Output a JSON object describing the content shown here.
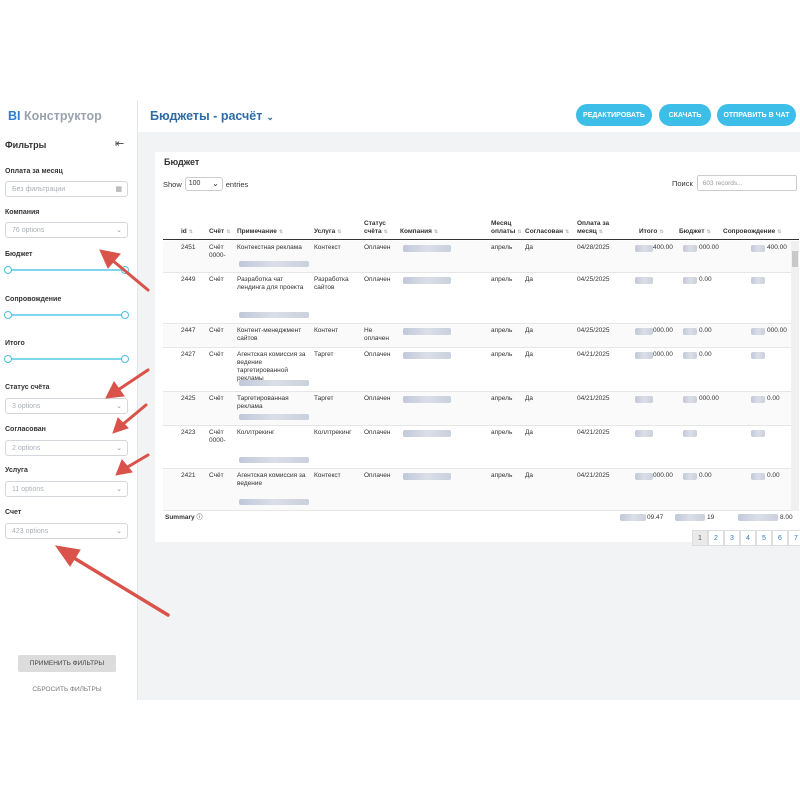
{
  "app": {
    "logo_bi": "BI",
    "logo_text": "Конструктор"
  },
  "header": {
    "title": "Бюджеты - расчёт",
    "buttons": [
      "РЕДАКТИРОВАТЬ",
      "СКАЧАТЬ",
      "ОТПРАВИТЬ В ЧАТ"
    ]
  },
  "sidebar": {
    "title": "Фильтры",
    "filters": {
      "payment_month": {
        "label": "Оплата за месяц",
        "placeholder": "Без фильтрации"
      },
      "company": {
        "label": "Компания",
        "value": "76 options"
      },
      "budget": {
        "label": "Бюджет"
      },
      "support": {
        "label": "Сопровождение"
      },
      "total": {
        "label": "Итого"
      },
      "invoice_status": {
        "label": "Статус счёта",
        "value": "3 options"
      },
      "agreed": {
        "label": "Согласован",
        "value": "2 options"
      },
      "service": {
        "label": "Услуга",
        "value": "11 options"
      },
      "invoice": {
        "label": "Счет",
        "value": "423 options"
      }
    },
    "apply_label": "ПРИМЕНИТЬ ФИЛЬТРЫ",
    "reset_label": "СБРОСИТЬ ФИЛЬТРЫ"
  },
  "table_card": {
    "title": "Бюджет",
    "show_label": "Show",
    "show_value": "100",
    "entries_label": "entries",
    "search_label": "Поиск",
    "search_placeholder": "603 records...",
    "columns": [
      "id",
      "Счёт",
      "Примечание",
      "Услуга",
      "Статус счёта",
      "Компания",
      "Месяц оплаты",
      "Согласован",
      "Оплата за месяц",
      "Итого",
      "Бюджет",
      "Сопровождение"
    ],
    "rows": [
      {
        "id": "2451",
        "invoice": "Счёт 0000-",
        "note": "Контекстная реклама",
        "service": "Контекст",
        "status": "Оплачен",
        "month": "апрель",
        "agreed": "Да",
        "date": "04/28/2025",
        "total": "400.00",
        "budget": "000.00",
        "support": "400.00"
      },
      {
        "id": "2449",
        "invoice": "Счёт",
        "note": "Разработка чат лендинга для проекта",
        "service": "Разработка сайтов",
        "status": "Оплачен",
        "month": "апрель",
        "agreed": "Да",
        "date": "04/25/2025",
        "total": "",
        "budget": "0.00",
        "support": ""
      },
      {
        "id": "2447",
        "invoice": "Счёт",
        "note": "Контент-менеджмент сайтов",
        "service": "Контент",
        "status": "Не оплачен",
        "month": "апрель",
        "agreed": "Да",
        "date": "04/25/2025",
        "total": "000.00",
        "budget": "0.00",
        "support": "000.00"
      },
      {
        "id": "2427",
        "invoice": "Счёт",
        "note": "Агентская комиссия за ведение таргетированной рекламы",
        "service": "Таргет",
        "status": "Оплачен",
        "month": "апрель",
        "agreed": "Да",
        "date": "04/21/2025",
        "total": "000.00",
        "budget": "0.00",
        "support": ""
      },
      {
        "id": "2425",
        "invoice": "Счёт",
        "note": "Таргетированная реклама",
        "service": "Таргет",
        "status": "Оплачен",
        "month": "апрель",
        "agreed": "Да",
        "date": "04/21/2025",
        "total": "",
        "budget": "000.00",
        "support": "0.00"
      },
      {
        "id": "2423",
        "invoice": "Счёт 0000-",
        "note": "Коллтрекинг",
        "service": "Коллтрекинг",
        "status": "Оплачен",
        "month": "апрель",
        "agreed": "Да",
        "date": "04/21/2025",
        "total": "",
        "budget": "",
        "support": ""
      },
      {
        "id": "2421",
        "invoice": "Счёт",
        "note": "Агентская комиссия за ведение",
        "service": "Контекст",
        "status": "Оплачен",
        "month": "апрель",
        "agreed": "Да",
        "date": "04/21/2025",
        "total": "000.00",
        "budget": "0.00",
        "support": "0.00"
      }
    ],
    "summary": {
      "label": "Summary",
      "total": "09.47",
      "budget": "19",
      "support": "8.00"
    },
    "pages": [
      "1",
      "2",
      "3",
      "4",
      "5",
      "6",
      "7"
    ],
    "active_page": "1"
  },
  "colors": {
    "accent": "#3dbee8",
    "title": "#2e6ca8",
    "annotation": "#d9534a"
  }
}
